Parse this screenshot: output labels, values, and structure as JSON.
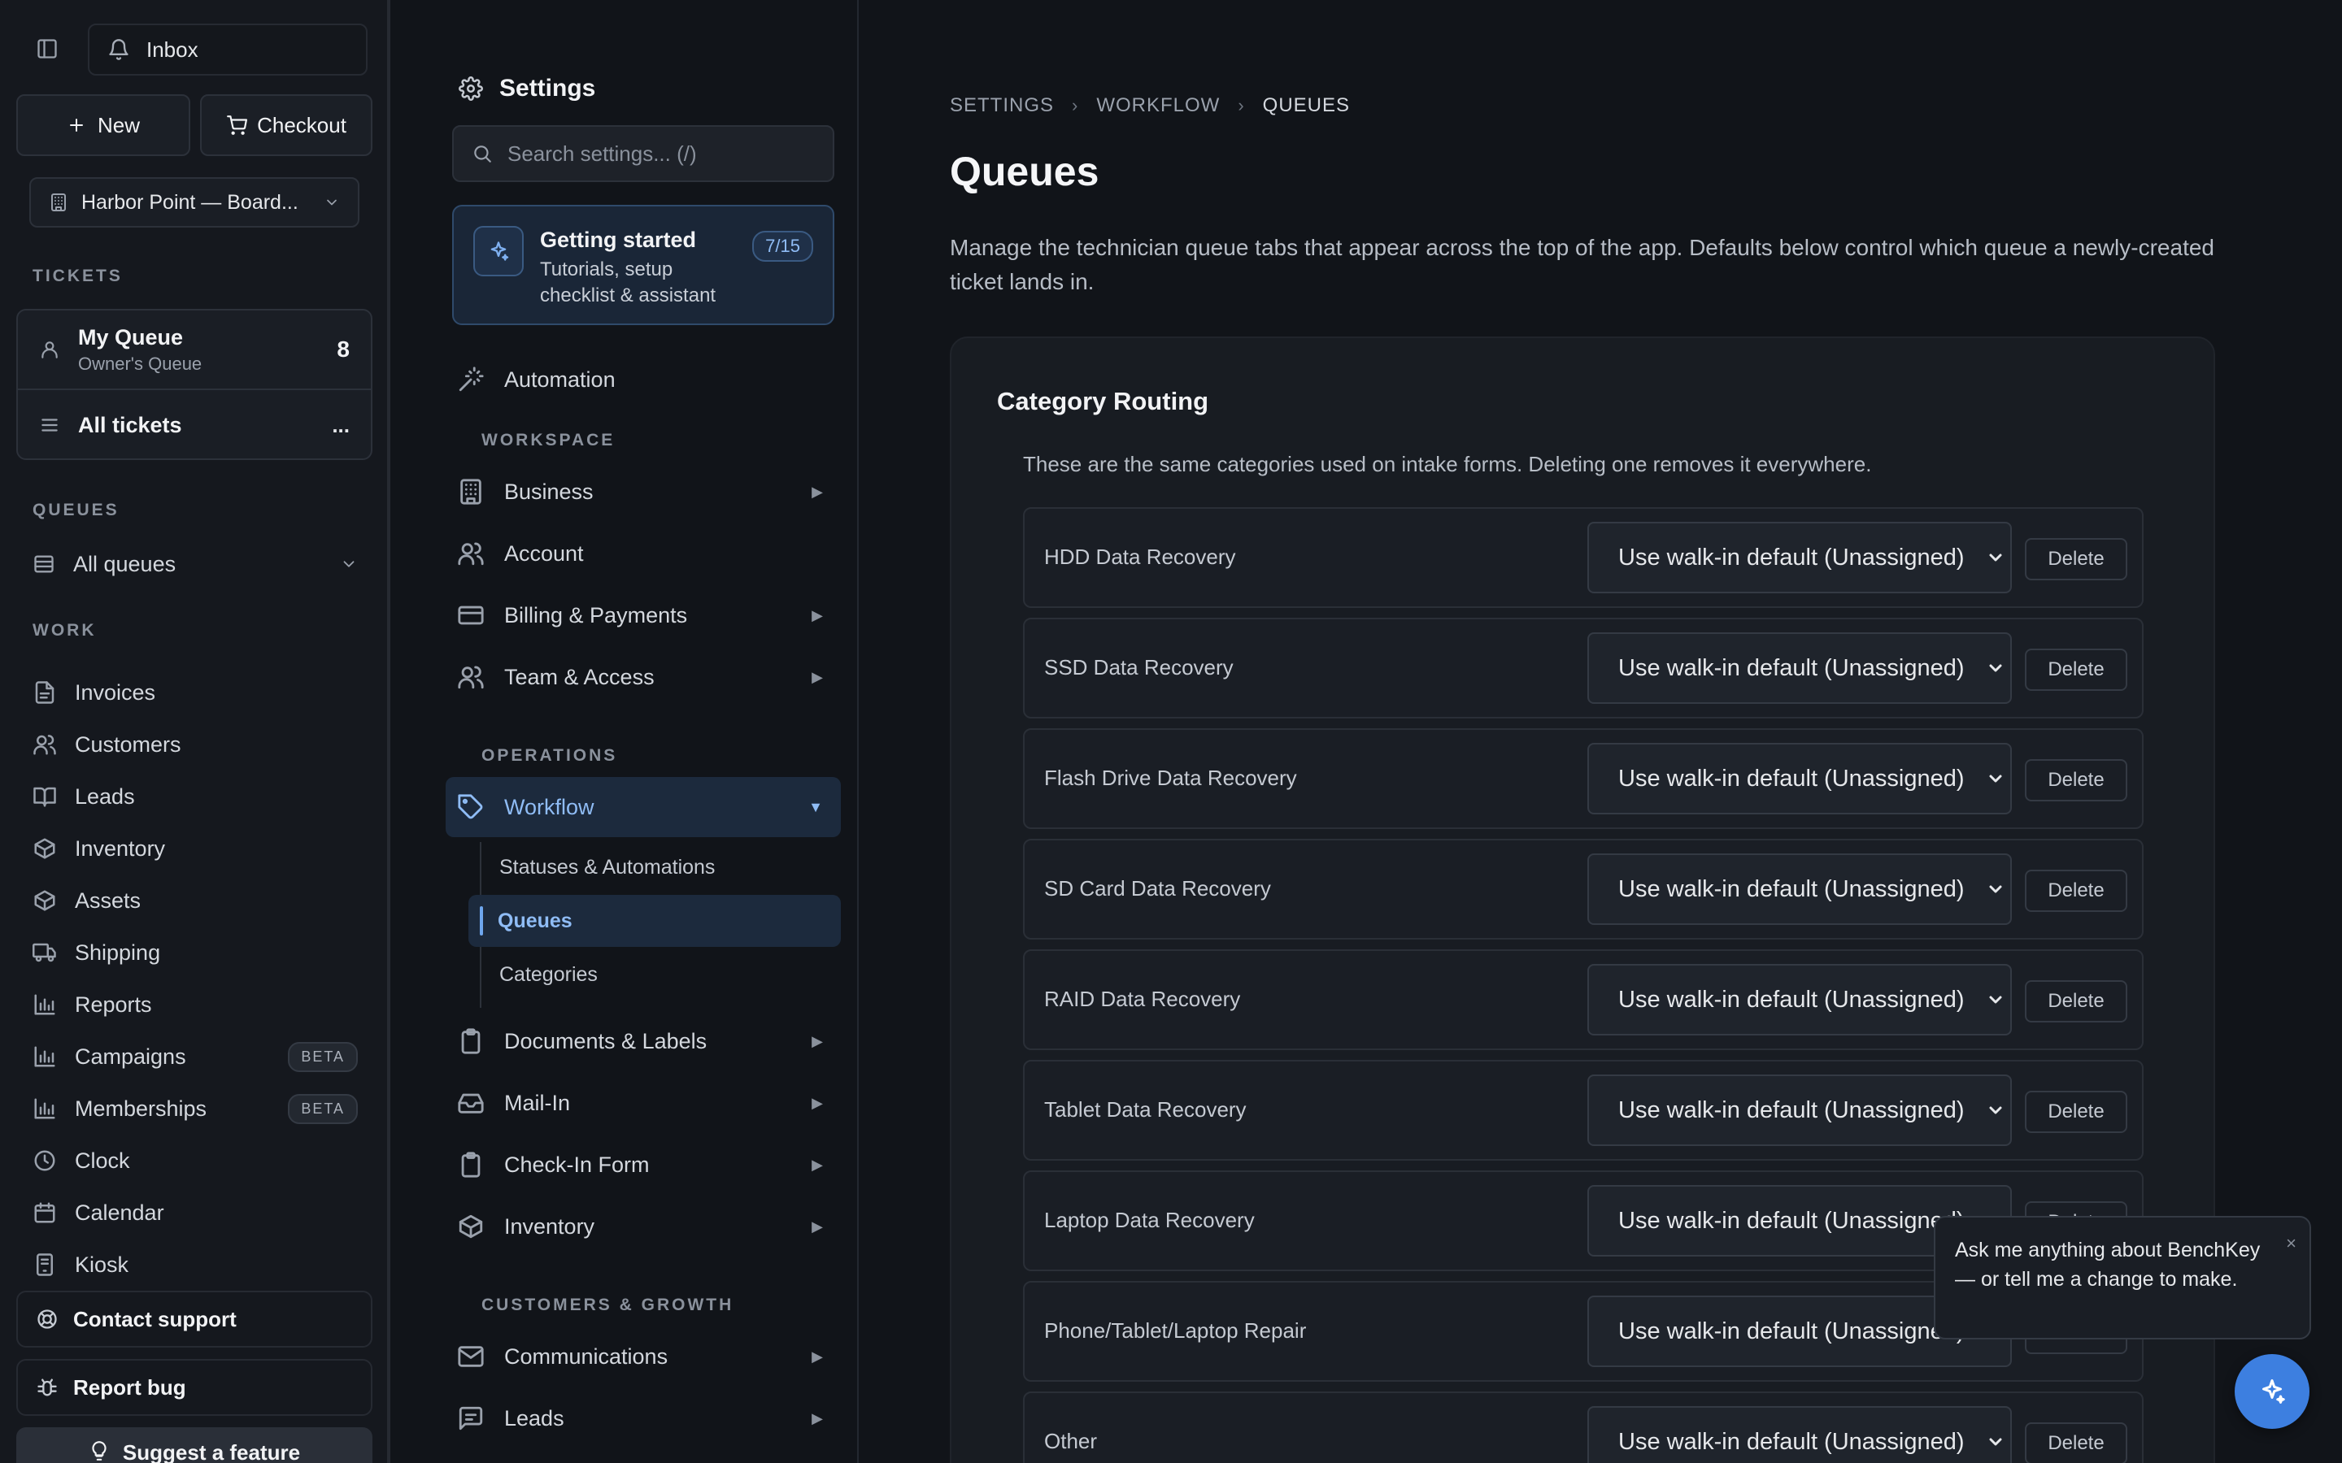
{
  "sidebar": {
    "inbox_label": "Inbox",
    "new_label": "New",
    "checkout_label": "Checkout",
    "org_label": "Harbor Point — Board...",
    "tickets_heading": "TICKETS",
    "my_queue": {
      "title": "My Queue",
      "subtitle": "Owner's Queue",
      "count": "8"
    },
    "all_tickets": {
      "title": "All tickets",
      "more": "..."
    },
    "queues_heading": "QUEUES",
    "all_queues_label": "All queues",
    "work_heading": "WORK",
    "work_items": [
      {
        "label": "Invoices",
        "icon": "file-icon"
      },
      {
        "label": "Customers",
        "icon": "users-icon"
      },
      {
        "label": "Leads",
        "icon": "book-icon"
      },
      {
        "label": "Inventory",
        "icon": "box-icon"
      },
      {
        "label": "Assets",
        "icon": "box-icon"
      },
      {
        "label": "Shipping",
        "icon": "truck-icon"
      },
      {
        "label": "Reports",
        "icon": "bar-chart-icon"
      },
      {
        "label": "Campaigns",
        "icon": "bar-chart-icon",
        "badge": "BETA"
      },
      {
        "label": "Memberships",
        "icon": "bar-chart-icon",
        "badge": "BETA"
      },
      {
        "label": "Clock",
        "icon": "clock-icon"
      },
      {
        "label": "Calendar",
        "icon": "calendar-icon"
      },
      {
        "label": "Kiosk",
        "icon": "tablet-icon"
      }
    ],
    "contact_support_label": "Contact support",
    "report_bug_label": "Report bug",
    "suggest_feature_label": "Suggest a feature"
  },
  "settings_nav": {
    "title": "Settings",
    "search_placeholder": "Search settings... (/)",
    "getting_started": {
      "title": "Getting started",
      "subtitle": "Tutorials, setup checklist & assistant",
      "progress": "7/15"
    },
    "automation_label": "Automation",
    "workspace_heading": "WORKSPACE",
    "workspace_items": [
      {
        "label": "Business",
        "arrow": "▶"
      },
      {
        "label": "Account",
        "arrow": ""
      },
      {
        "label": "Billing & Payments",
        "arrow": "▶"
      },
      {
        "label": "Team & Access",
        "arrow": "▶"
      }
    ],
    "operations_heading": "OPERATIONS",
    "workflow": {
      "label": "Workflow",
      "arrow": "▼"
    },
    "workflow_subitems": [
      "Statuses & Automations",
      "Queues",
      "Categories"
    ],
    "operations_items": [
      {
        "label": "Documents & Labels",
        "arrow": "▶"
      },
      {
        "label": "Mail-In",
        "arrow": "▶"
      },
      {
        "label": "Check-In Form",
        "arrow": "▶"
      },
      {
        "label": "Inventory",
        "arrow": "▶"
      }
    ],
    "growth_heading": "CUSTOMERS & GROWTH",
    "growth_items": [
      {
        "label": "Communications",
        "arrow": "▶"
      },
      {
        "label": "Leads",
        "arrow": "▶"
      }
    ]
  },
  "main": {
    "breadcrumb": [
      "SETTINGS",
      "WORKFLOW",
      "QUEUES"
    ],
    "breadcrumb_sep": "›",
    "title": "Queues",
    "description": "Manage the technician queue tabs that appear across the top of the app. Defaults below control which queue a newly-created ticket lands in.",
    "card": {
      "title": "Category Routing",
      "description": "These are the same categories used on intake forms. Deleting one removes it everywhere.",
      "delete_label": "Delete",
      "rows": [
        {
          "name": "HDD Data Recovery",
          "value": "Use walk-in default (Unassigned)"
        },
        {
          "name": "SSD Data Recovery",
          "value": "Use walk-in default (Unassigned)"
        },
        {
          "name": "Flash Drive Data Recovery",
          "value": "Use walk-in default (Unassigned)"
        },
        {
          "name": "SD Card Data Recovery",
          "value": "Use walk-in default (Unassigned)"
        },
        {
          "name": "RAID Data Recovery",
          "value": "Use walk-in default (Unassigned)"
        },
        {
          "name": "Tablet Data Recovery",
          "value": "Use walk-in default (Unassigned)"
        },
        {
          "name": "Laptop Data Recovery",
          "value": "Use walk-in default (Unassigned)"
        },
        {
          "name": "Phone/Tablet/Laptop Repair",
          "value": "Use walk-in default (Unassigned)"
        },
        {
          "name": "Other",
          "value": "Use walk-in default (Unassigned)"
        }
      ]
    }
  },
  "assistant": {
    "message": "Ask me anything about BenchKey — or tell me a change to make.",
    "close": "×"
  },
  "colors": {
    "accent": "#3d7fe0",
    "active_bg": "#1c2a3d",
    "active_text": "#8fbcf5",
    "background": "#111419"
  }
}
